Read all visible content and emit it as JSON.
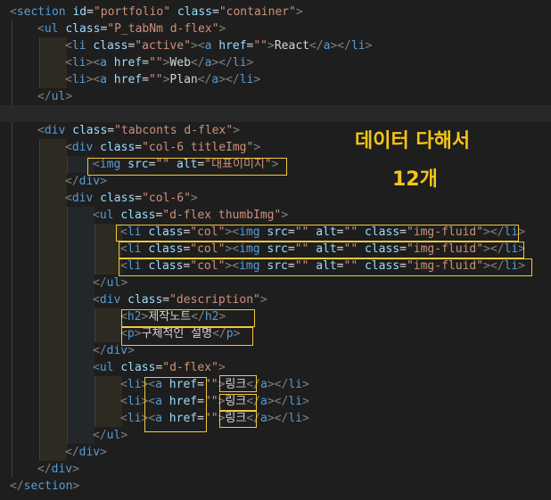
{
  "lines": [
    {
      "indent": 0,
      "parts": [
        [
          "br",
          "<"
        ],
        [
          "tag",
          "section"
        ],
        [
          "txt",
          " "
        ],
        [
          "attr",
          "id"
        ],
        [
          "txt",
          "="
        ],
        [
          "str",
          "\"portfolio\""
        ],
        [
          "txt",
          " "
        ],
        [
          "attr",
          "class"
        ],
        [
          "txt",
          "="
        ],
        [
          "str",
          "\"container\""
        ],
        [
          "br",
          ">"
        ]
      ]
    },
    {
      "indent": 1,
      "parts": [
        [
          "br",
          "<"
        ],
        [
          "tag",
          "ul"
        ],
        [
          "txt",
          " "
        ],
        [
          "attr",
          "class"
        ],
        [
          "txt",
          "="
        ],
        [
          "str",
          "\"P_tabNm d-flex\""
        ],
        [
          "br",
          ">"
        ]
      ]
    },
    {
      "indent": 2,
      "parts": [
        [
          "br",
          "<"
        ],
        [
          "tag",
          "li"
        ],
        [
          "txt",
          " "
        ],
        [
          "attr",
          "class"
        ],
        [
          "txt",
          "="
        ],
        [
          "str",
          "\"active\""
        ],
        [
          "br",
          ">"
        ],
        [
          "br",
          "<"
        ],
        [
          "tag",
          "a"
        ],
        [
          "txt",
          " "
        ],
        [
          "attr",
          "href"
        ],
        [
          "txt",
          "="
        ],
        [
          "str",
          "\"\""
        ],
        [
          "br",
          ">"
        ],
        [
          "txt",
          "React"
        ],
        [
          "br",
          "</"
        ],
        [
          "tag",
          "a"
        ],
        [
          "br",
          "></"
        ],
        [
          "tag",
          "li"
        ],
        [
          "br",
          ">"
        ]
      ]
    },
    {
      "indent": 2,
      "parts": [
        [
          "br",
          "<"
        ],
        [
          "tag",
          "li"
        ],
        [
          "br",
          "><"
        ],
        [
          "tag",
          "a"
        ],
        [
          "txt",
          " "
        ],
        [
          "attr",
          "href"
        ],
        [
          "txt",
          "="
        ],
        [
          "str",
          "\"\""
        ],
        [
          "br",
          ">"
        ],
        [
          "txt",
          "Web"
        ],
        [
          "br",
          "</"
        ],
        [
          "tag",
          "a"
        ],
        [
          "br",
          "></"
        ],
        [
          "tag",
          "li"
        ],
        [
          "br",
          ">"
        ]
      ]
    },
    {
      "indent": 2,
      "parts": [
        [
          "br",
          "<"
        ],
        [
          "tag",
          "li"
        ],
        [
          "br",
          "><"
        ],
        [
          "tag",
          "a"
        ],
        [
          "txt",
          " "
        ],
        [
          "attr",
          "href"
        ],
        [
          "txt",
          "="
        ],
        [
          "str",
          "\"\""
        ],
        [
          "br",
          ">"
        ],
        [
          "txt",
          "Plan"
        ],
        [
          "br",
          "</"
        ],
        [
          "tag",
          "a"
        ],
        [
          "br",
          "></"
        ],
        [
          "tag",
          "li"
        ],
        [
          "br",
          ">"
        ]
      ]
    },
    {
      "indent": 1,
      "parts": [
        [
          "br",
          "</"
        ],
        [
          "tag",
          "ul"
        ],
        [
          "br",
          ">"
        ]
      ]
    },
    {
      "indent": 0,
      "parts": [],
      "highlight": true
    },
    {
      "indent": 1,
      "parts": [
        [
          "br",
          "<"
        ],
        [
          "tag",
          "div"
        ],
        [
          "txt",
          " "
        ],
        [
          "attr",
          "class"
        ],
        [
          "txt",
          "="
        ],
        [
          "str",
          "\"tabconts d-flex\""
        ],
        [
          "br",
          ">"
        ]
      ]
    },
    {
      "indent": 2,
      "parts": [
        [
          "br",
          "<"
        ],
        [
          "tag",
          "div"
        ],
        [
          "txt",
          " "
        ],
        [
          "attr",
          "class"
        ],
        [
          "txt",
          "="
        ],
        [
          "str",
          "\"col-6 titleImg\""
        ],
        [
          "br",
          ">"
        ]
      ]
    },
    {
      "indent": 3,
      "parts": [
        [
          "br",
          "<"
        ],
        [
          "tag",
          "img"
        ],
        [
          "txt",
          " "
        ],
        [
          "attr",
          "src"
        ],
        [
          "txt",
          "="
        ],
        [
          "str",
          "\"\""
        ],
        [
          "txt",
          " "
        ],
        [
          "attr",
          "alt"
        ],
        [
          "txt",
          "="
        ],
        [
          "str",
          "\"대표이미지\""
        ],
        [
          "br",
          ">"
        ]
      ]
    },
    {
      "indent": 2,
      "parts": [
        [
          "br",
          "</"
        ],
        [
          "tag",
          "div"
        ],
        [
          "br",
          ">"
        ]
      ]
    },
    {
      "indent": 2,
      "parts": [
        [
          "br",
          "<"
        ],
        [
          "tag",
          "div"
        ],
        [
          "txt",
          " "
        ],
        [
          "attr",
          "class"
        ],
        [
          "txt",
          "="
        ],
        [
          "str",
          "\"col-6\""
        ],
        [
          "br",
          ">"
        ]
      ]
    },
    {
      "indent": 3,
      "parts": [
        [
          "br",
          "<"
        ],
        [
          "tag",
          "ul"
        ],
        [
          "txt",
          " "
        ],
        [
          "attr",
          "class"
        ],
        [
          "txt",
          "="
        ],
        [
          "str",
          "\"d-flex thumbImg\""
        ],
        [
          "br",
          ">"
        ]
      ]
    },
    {
      "indent": 4,
      "parts": [
        [
          "br",
          "<"
        ],
        [
          "tag",
          "li"
        ],
        [
          "txt",
          " "
        ],
        [
          "attr",
          "class"
        ],
        [
          "txt",
          "="
        ],
        [
          "str",
          "\"col\""
        ],
        [
          "br",
          "><"
        ],
        [
          "tag",
          "img"
        ],
        [
          "txt",
          " "
        ],
        [
          "attr",
          "src"
        ],
        [
          "txt",
          "="
        ],
        [
          "str",
          "\"\""
        ],
        [
          "txt",
          " "
        ],
        [
          "attr",
          "alt"
        ],
        [
          "txt",
          "="
        ],
        [
          "str",
          "\"\""
        ],
        [
          "txt",
          " "
        ],
        [
          "attr",
          "class"
        ],
        [
          "txt",
          "="
        ],
        [
          "str",
          "\"img-fluid\""
        ],
        [
          "br",
          "></"
        ],
        [
          "tag",
          "li"
        ],
        [
          "br",
          ">"
        ]
      ]
    },
    {
      "indent": 4,
      "parts": [
        [
          "br",
          "<"
        ],
        [
          "tag",
          "li"
        ],
        [
          "txt",
          " "
        ],
        [
          "attr",
          "class"
        ],
        [
          "txt",
          "="
        ],
        [
          "str",
          "\"col\""
        ],
        [
          "br",
          "><"
        ],
        [
          "tag",
          "img"
        ],
        [
          "txt",
          " "
        ],
        [
          "attr",
          "src"
        ],
        [
          "txt",
          "="
        ],
        [
          "str",
          "\"\""
        ],
        [
          "txt",
          " "
        ],
        [
          "attr",
          "alt"
        ],
        [
          "txt",
          "="
        ],
        [
          "str",
          "\"\""
        ],
        [
          "txt",
          " "
        ],
        [
          "attr",
          "class"
        ],
        [
          "txt",
          "="
        ],
        [
          "str",
          "\"img-fluid\""
        ],
        [
          "br",
          "></"
        ],
        [
          "tag",
          "li"
        ],
        [
          "br",
          ">"
        ]
      ]
    },
    {
      "indent": 4,
      "parts": [
        [
          "br",
          "<"
        ],
        [
          "tag",
          "li"
        ],
        [
          "txt",
          " "
        ],
        [
          "attr",
          "class"
        ],
        [
          "txt",
          "="
        ],
        [
          "str",
          "\"col\""
        ],
        [
          "br",
          "><"
        ],
        [
          "tag",
          "img"
        ],
        [
          "txt",
          " "
        ],
        [
          "attr",
          "src"
        ],
        [
          "txt",
          "="
        ],
        [
          "str",
          "\"\""
        ],
        [
          "txt",
          " "
        ],
        [
          "attr",
          "alt"
        ],
        [
          "txt",
          "="
        ],
        [
          "str",
          "\"\""
        ],
        [
          "txt",
          " "
        ],
        [
          "attr",
          "class"
        ],
        [
          "txt",
          "="
        ],
        [
          "str",
          "\"img-fluid\""
        ],
        [
          "br",
          "></"
        ],
        [
          "tag",
          "li"
        ],
        [
          "br",
          ">"
        ]
      ]
    },
    {
      "indent": 3,
      "parts": [
        [
          "br",
          "</"
        ],
        [
          "tag",
          "ul"
        ],
        [
          "br",
          ">"
        ]
      ]
    },
    {
      "indent": 3,
      "parts": [
        [
          "br",
          "<"
        ],
        [
          "tag",
          "div"
        ],
        [
          "txt",
          " "
        ],
        [
          "attr",
          "class"
        ],
        [
          "txt",
          "="
        ],
        [
          "str",
          "\"description\""
        ],
        [
          "br",
          ">"
        ]
      ]
    },
    {
      "indent": 4,
      "parts": [
        [
          "br",
          "<"
        ],
        [
          "tag",
          "h2"
        ],
        [
          "br",
          ">"
        ],
        [
          "txt",
          "제작노트"
        ],
        [
          "br",
          "</"
        ],
        [
          "tag",
          "h2"
        ],
        [
          "br",
          ">"
        ]
      ]
    },
    {
      "indent": 4,
      "parts": [
        [
          "br",
          "<"
        ],
        [
          "tag",
          "p"
        ],
        [
          "br",
          ">"
        ],
        [
          "txt",
          "구체적인 설명"
        ],
        [
          "br",
          "</"
        ],
        [
          "tag",
          "p"
        ],
        [
          "br",
          ">"
        ]
      ]
    },
    {
      "indent": 3,
      "parts": [
        [
          "br",
          "</"
        ],
        [
          "tag",
          "div"
        ],
        [
          "br",
          ">"
        ]
      ]
    },
    {
      "indent": 3,
      "parts": [
        [
          "br",
          "<"
        ],
        [
          "tag",
          "ul"
        ],
        [
          "txt",
          " "
        ],
        [
          "attr",
          "class"
        ],
        [
          "txt",
          "="
        ],
        [
          "str",
          "\"d-flex\""
        ],
        [
          "br",
          ">"
        ]
      ]
    },
    {
      "indent": 4,
      "parts": [
        [
          "br",
          "<"
        ],
        [
          "tag",
          "li"
        ],
        [
          "br",
          "><"
        ],
        [
          "tag",
          "a"
        ],
        [
          "txt",
          " "
        ],
        [
          "attr",
          "href"
        ],
        [
          "txt",
          "="
        ],
        [
          "str",
          "\"\""
        ],
        [
          "br",
          ">"
        ],
        [
          "txt",
          "링크"
        ],
        [
          "br",
          "</"
        ],
        [
          "tag",
          "a"
        ],
        [
          "br",
          "></"
        ],
        [
          "tag",
          "li"
        ],
        [
          "br",
          ">"
        ]
      ]
    },
    {
      "indent": 4,
      "parts": [
        [
          "br",
          "<"
        ],
        [
          "tag",
          "li"
        ],
        [
          "br",
          "><"
        ],
        [
          "tag",
          "a"
        ],
        [
          "txt",
          " "
        ],
        [
          "attr",
          "href"
        ],
        [
          "txt",
          "="
        ],
        [
          "str",
          "\"\""
        ],
        [
          "br",
          ">"
        ],
        [
          "txt",
          "링크"
        ],
        [
          "br",
          "</"
        ],
        [
          "tag",
          "a"
        ],
        [
          "br",
          "></"
        ],
        [
          "tag",
          "li"
        ],
        [
          "br",
          ">"
        ]
      ]
    },
    {
      "indent": 4,
      "parts": [
        [
          "br",
          "<"
        ],
        [
          "tag",
          "li"
        ],
        [
          "br",
          "><"
        ],
        [
          "tag",
          "a"
        ],
        [
          "txt",
          " "
        ],
        [
          "attr",
          "href"
        ],
        [
          "txt",
          "="
        ],
        [
          "str",
          "\"\""
        ],
        [
          "br",
          ">"
        ],
        [
          "txt",
          "링크"
        ],
        [
          "br",
          "</"
        ],
        [
          "tag",
          "a"
        ],
        [
          "br",
          "></"
        ],
        [
          "tag",
          "li"
        ],
        [
          "br",
          ">"
        ]
      ]
    },
    {
      "indent": 3,
      "parts": [
        [
          "br",
          "</"
        ],
        [
          "tag",
          "ul"
        ],
        [
          "br",
          ">"
        ]
      ]
    },
    {
      "indent": 2,
      "parts": [
        [
          "br",
          "</"
        ],
        [
          "tag",
          "div"
        ],
        [
          "br",
          ">"
        ]
      ]
    },
    {
      "indent": 1,
      "parts": [
        [
          "br",
          "</"
        ],
        [
          "tag",
          "div"
        ],
        [
          "br",
          ">"
        ]
      ]
    },
    {
      "indent": 0,
      "parts": [
        [
          "br",
          "</"
        ],
        [
          "tag",
          "section"
        ],
        [
          "br",
          ">"
        ]
      ]
    }
  ],
  "annotation": {
    "line1": "데이터 다해서",
    "line2": "12개"
  },
  "colors": {
    "background": "#1e1e1e",
    "tag": "#569cd6",
    "attribute": "#9cdcfe",
    "string": "#ce9178",
    "bracket": "#808080",
    "highlight_box": "#f2c83b",
    "annotation": "#f5c518"
  }
}
